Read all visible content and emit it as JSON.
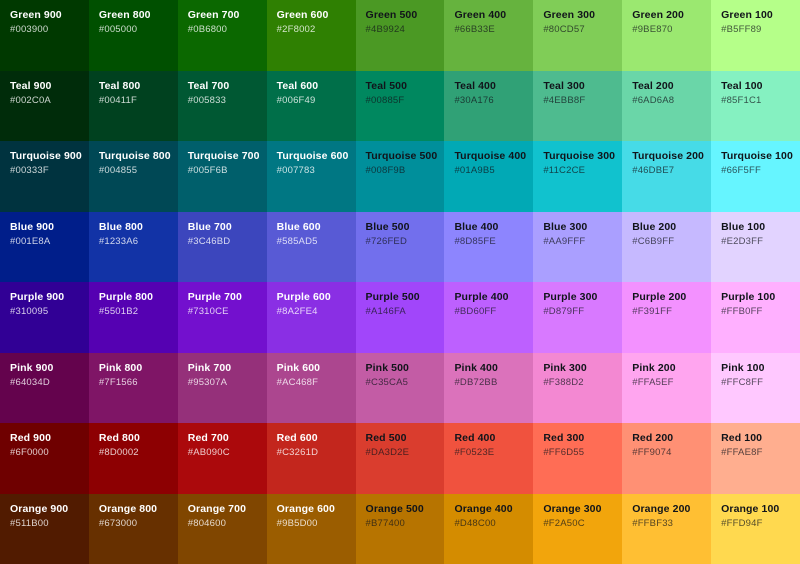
{
  "palette": {
    "columns": [
      "900",
      "800",
      "700",
      "600",
      "500",
      "400",
      "300",
      "200",
      "100"
    ],
    "rows": [
      {
        "family": "Green",
        "swatches": [
          {
            "name": "Green 900",
            "hex": "#003900",
            "text": "light"
          },
          {
            "name": "Green 800",
            "hex": "#005000",
            "text": "light"
          },
          {
            "name": "Green 700",
            "hex": "#0B6800",
            "text": "light"
          },
          {
            "name": "Green 600",
            "hex": "#2F8002",
            "text": "light"
          },
          {
            "name": "Green 500",
            "hex": "#4B9924",
            "text": "dark"
          },
          {
            "name": "Green 400",
            "hex": "#66B33E",
            "text": "dark"
          },
          {
            "name": "Green 300",
            "hex": "#80CD57",
            "text": "dark"
          },
          {
            "name": "Green 200",
            "hex": "#9BE870",
            "text": "dark"
          },
          {
            "name": "Green 100",
            "hex": "#B5FF89",
            "text": "dark"
          }
        ]
      },
      {
        "family": "Teal",
        "swatches": [
          {
            "name": "Teal 900",
            "hex": "#002C0A",
            "text": "light"
          },
          {
            "name": "Teal 800",
            "hex": "#00411F",
            "text": "light"
          },
          {
            "name": "Teal 700",
            "hex": "#005833",
            "text": "light"
          },
          {
            "name": "Teal 600",
            "hex": "#006F49",
            "text": "light"
          },
          {
            "name": "Teal 500",
            "hex": "#00885F",
            "text": "dark"
          },
          {
            "name": "Teal 400",
            "hex": "#30A176",
            "text": "dark"
          },
          {
            "name": "Teal 300",
            "hex": "#4EBB8F",
            "text": "dark"
          },
          {
            "name": "Teal 200",
            "hex": "#6AD6A8",
            "text": "dark"
          },
          {
            "name": "Teal 100",
            "hex": "#85F1C1",
            "text": "dark"
          }
        ]
      },
      {
        "family": "Turquoise",
        "swatches": [
          {
            "name": "Turquoise 900",
            "hex": "#00333F",
            "text": "light"
          },
          {
            "name": "Turquoise 800",
            "hex": "#004855",
            "text": "light"
          },
          {
            "name": "Turquoise 700",
            "hex": "#005F6B",
            "text": "light"
          },
          {
            "name": "Turquoise 600",
            "hex": "#007783",
            "text": "light"
          },
          {
            "name": "Turquoise 500",
            "hex": "#008F9B",
            "text": "dark"
          },
          {
            "name": "Turquoise 400",
            "hex": "#01A9B5",
            "text": "dark"
          },
          {
            "name": "Turquoise 300",
            "hex": "#11C2CE",
            "text": "dark"
          },
          {
            "name": "Turquoise 200",
            "hex": "#46DBE7",
            "text": "dark"
          },
          {
            "name": "Turquoise 100",
            "hex": "#66F5FF",
            "text": "dark"
          }
        ]
      },
      {
        "family": "Blue",
        "swatches": [
          {
            "name": "Blue 900",
            "hex": "#001E8A",
            "text": "light"
          },
          {
            "name": "Blue 800",
            "hex": "#1233A6",
            "text": "light"
          },
          {
            "name": "Blue 700",
            "hex": "#3C46BD",
            "text": "light"
          },
          {
            "name": "Blue 600",
            "hex": "#585AD5",
            "text": "light"
          },
          {
            "name": "Blue 500",
            "hex": "#726FED",
            "text": "dark"
          },
          {
            "name": "Blue 400",
            "hex": "#8D85FE",
            "text": "dark"
          },
          {
            "name": "Blue 300",
            "hex": "#AA9FFF",
            "text": "dark"
          },
          {
            "name": "Blue 200",
            "hex": "#C6B9FF",
            "text": "dark"
          },
          {
            "name": "Blue 100",
            "hex": "#E2D3FF",
            "text": "dark"
          }
        ]
      },
      {
        "family": "Purple",
        "swatches": [
          {
            "name": "Purple 900",
            "hex": "#310095",
            "text": "light"
          },
          {
            "name": "Purple 800",
            "hex": "#5501B2",
            "text": "light"
          },
          {
            "name": "Purple 700",
            "hex": "#7310CE",
            "text": "light"
          },
          {
            "name": "Purple 600",
            "hex": "#8A2FE4",
            "text": "light"
          },
          {
            "name": "Purple 500",
            "hex": "#A146FA",
            "text": "dark"
          },
          {
            "name": "Purple 400",
            "hex": "#BD60FF",
            "text": "dark"
          },
          {
            "name": "Purple 300",
            "hex": "#D879FF",
            "text": "dark"
          },
          {
            "name": "Purple 200",
            "hex": "#F391FF",
            "text": "dark"
          },
          {
            "name": "Purple 100",
            "hex": "#FFB0FF",
            "text": "dark"
          }
        ]
      },
      {
        "family": "Pink",
        "swatches": [
          {
            "name": "Pink 900",
            "hex": "#64034D",
            "text": "light"
          },
          {
            "name": "Pink 800",
            "hex": "#7F1566",
            "text": "light"
          },
          {
            "name": "Pink 700",
            "hex": "#95307A",
            "text": "light"
          },
          {
            "name": "Pink 600",
            "hex": "#AC468F",
            "text": "light"
          },
          {
            "name": "Pink 500",
            "hex": "#C35CA5",
            "text": "dark"
          },
          {
            "name": "Pink 400",
            "hex": "#DB72BB",
            "text": "dark"
          },
          {
            "name": "Pink 300",
            "hex": "#F388D2",
            "text": "dark"
          },
          {
            "name": "Pink 200",
            "hex": "#FFA5EF",
            "text": "dark"
          },
          {
            "name": "Pink 100",
            "hex": "#FFC8FF",
            "text": "dark"
          }
        ]
      },
      {
        "family": "Red",
        "swatches": [
          {
            "name": "Red 900",
            "hex": "#6F0000",
            "text": "light"
          },
          {
            "name": "Red 800",
            "hex": "#8D0002",
            "text": "light"
          },
          {
            "name": "Red 700",
            "hex": "#AB090C",
            "text": "light"
          },
          {
            "name": "Red 600",
            "hex": "#C3261D",
            "text": "light"
          },
          {
            "name": "Red 500",
            "hex": "#DA3D2E",
            "text": "dark"
          },
          {
            "name": "Red 400",
            "hex": "#F0523E",
            "text": "dark"
          },
          {
            "name": "Red 300",
            "hex": "#FF6D55",
            "text": "dark"
          },
          {
            "name": "Red 200",
            "hex": "#FF9074",
            "text": "dark"
          },
          {
            "name": "Red 100",
            "hex": "#FFAE8F",
            "text": "dark"
          }
        ]
      },
      {
        "family": "Orange",
        "swatches": [
          {
            "name": "Orange 900",
            "hex": "#511B00",
            "text": "light"
          },
          {
            "name": "Orange 800",
            "hex": "#673000",
            "text": "light"
          },
          {
            "name": "Orange 700",
            "hex": "#804600",
            "text": "light"
          },
          {
            "name": "Orange 600",
            "hex": "#9B5D00",
            "text": "light"
          },
          {
            "name": "Orange 500",
            "hex": "#B77400",
            "text": "dark"
          },
          {
            "name": "Orange 400",
            "hex": "#D48C00",
            "text": "dark"
          },
          {
            "name": "Orange 300",
            "hex": "#F2A50C",
            "text": "dark"
          },
          {
            "name": "Orange 200",
            "hex": "#FFBF33",
            "text": "dark"
          },
          {
            "name": "Orange 100",
            "hex": "#FFD94F",
            "text": "dark"
          }
        ]
      }
    ]
  }
}
